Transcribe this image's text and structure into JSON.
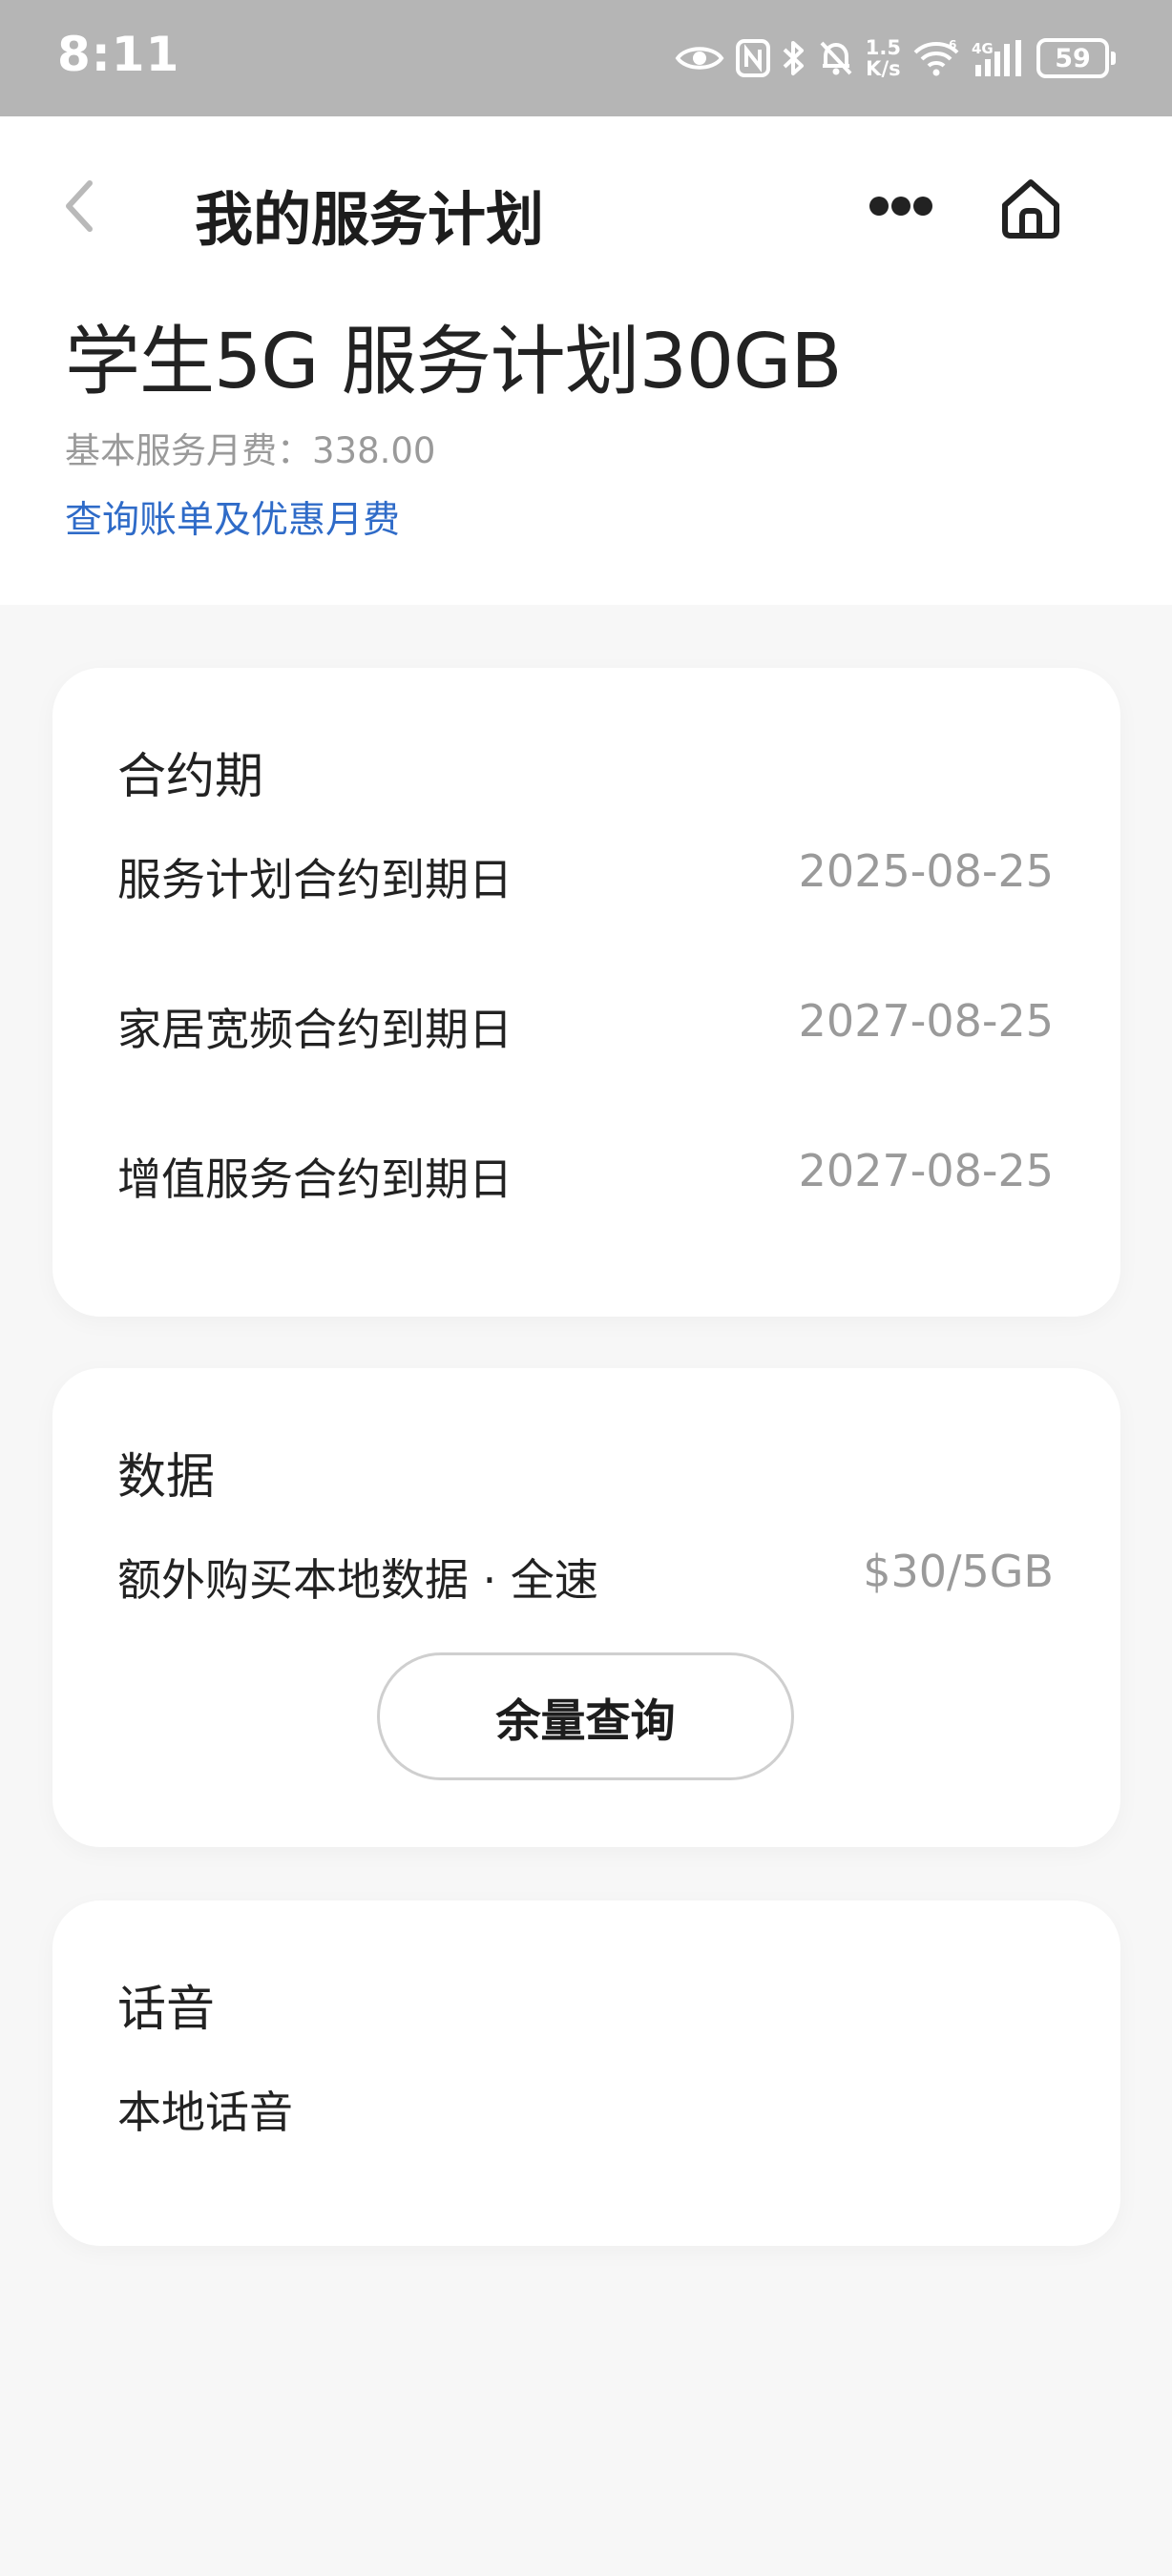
{
  "status_bar": {
    "time": "8:11",
    "net_speed_value": "1.5",
    "net_speed_unit": "K/s",
    "battery": "59",
    "icons": [
      "eye-icon",
      "nfc-icon",
      "bluetooth-icon",
      "mute-icon",
      "wifi-icon",
      "signal-4g-icon",
      "battery-icon"
    ]
  },
  "header": {
    "title": "我的服务计划",
    "back_icon": "chevron-left-icon",
    "more_icon": "more-dots-icon",
    "home_icon": "home-icon"
  },
  "plan": {
    "name": "学生5G 服务计划30GB",
    "fee": "基本服务月费：338.00",
    "bill_link": "查询账单及优惠月费"
  },
  "contract": {
    "title": "合约期",
    "rows": [
      {
        "label": "服务计划合约到期日",
        "value": "2025-08-25"
      },
      {
        "label": "家居宽频合约到期日",
        "value": "2027-08-25"
      },
      {
        "label": "增值服务合约到期日",
        "value": "2027-08-25"
      }
    ]
  },
  "data_section": {
    "title": "数据",
    "row_label": "额外购买本地数据 · 全速",
    "row_value": "$30/5GB",
    "button_label": "余量查询"
  },
  "voice": {
    "title": "话音",
    "row_label": "本地话音"
  },
  "colors": {
    "status_bar_bg": "#b5b5b5",
    "page_bg": "#f7f7f7",
    "link_blue": "#2f6bc8",
    "secondary_text": "#9a9a9a"
  }
}
